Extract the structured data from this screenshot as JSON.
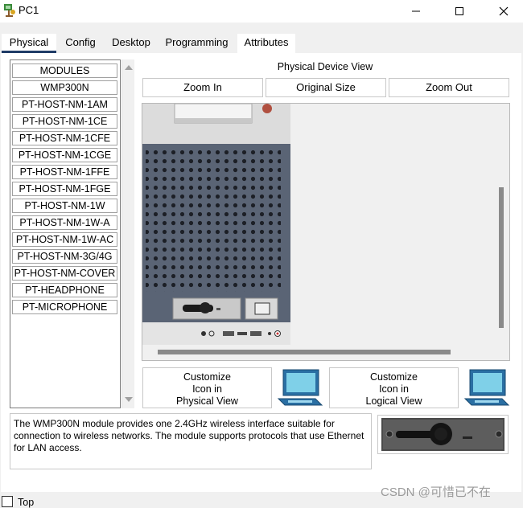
{
  "window": {
    "title": "PC1",
    "icon": "pc-tree-icon",
    "controls": [
      "minimize-icon",
      "maximize-icon",
      "close-icon"
    ]
  },
  "tabs": [
    {
      "label": "Physical",
      "active": true
    },
    {
      "label": "Config",
      "active": false
    },
    {
      "label": "Desktop",
      "active": false
    },
    {
      "label": "Programming",
      "active": false
    },
    {
      "label": "Attributes",
      "active": false
    }
  ],
  "modules": {
    "items": [
      "MODULES",
      "WMP300N",
      "PT-HOST-NM-1AM",
      "PT-HOST-NM-1CE",
      "PT-HOST-NM-1CFE",
      "PT-HOST-NM-1CGE",
      "PT-HOST-NM-1FFE",
      "PT-HOST-NM-1FGE",
      "PT-HOST-NM-1W",
      "PT-HOST-NM-1W-A",
      "PT-HOST-NM-1W-AC",
      "PT-HOST-NM-3G/4G",
      "PT-HOST-NM-COVER",
      "PT-HEADPHONE",
      "PT-MICROPHONE"
    ]
  },
  "device_view": {
    "title": "Physical Device View",
    "zoom_in": "Zoom In",
    "original_size": "Original Size",
    "zoom_out": "Zoom Out"
  },
  "customize": {
    "physical": [
      "Customize",
      "Icon in",
      "Physical View"
    ],
    "logical": [
      "Customize",
      "Icon in",
      "Logical View"
    ]
  },
  "description": "The WMP300N module provides one 2.4GHz wireless interface suitable for connection to wireless networks. The module supports protocols that use Ethernet for LAN access.",
  "bottom": {
    "top_label": "Top",
    "top_checked": false
  },
  "watermark": "CSDN @可惜已不在",
  "colors": {
    "active_tab_underline": "#1f3b66",
    "chassis": "#5a6475",
    "panel": "#ffffff",
    "background": "#f0f0f0"
  }
}
